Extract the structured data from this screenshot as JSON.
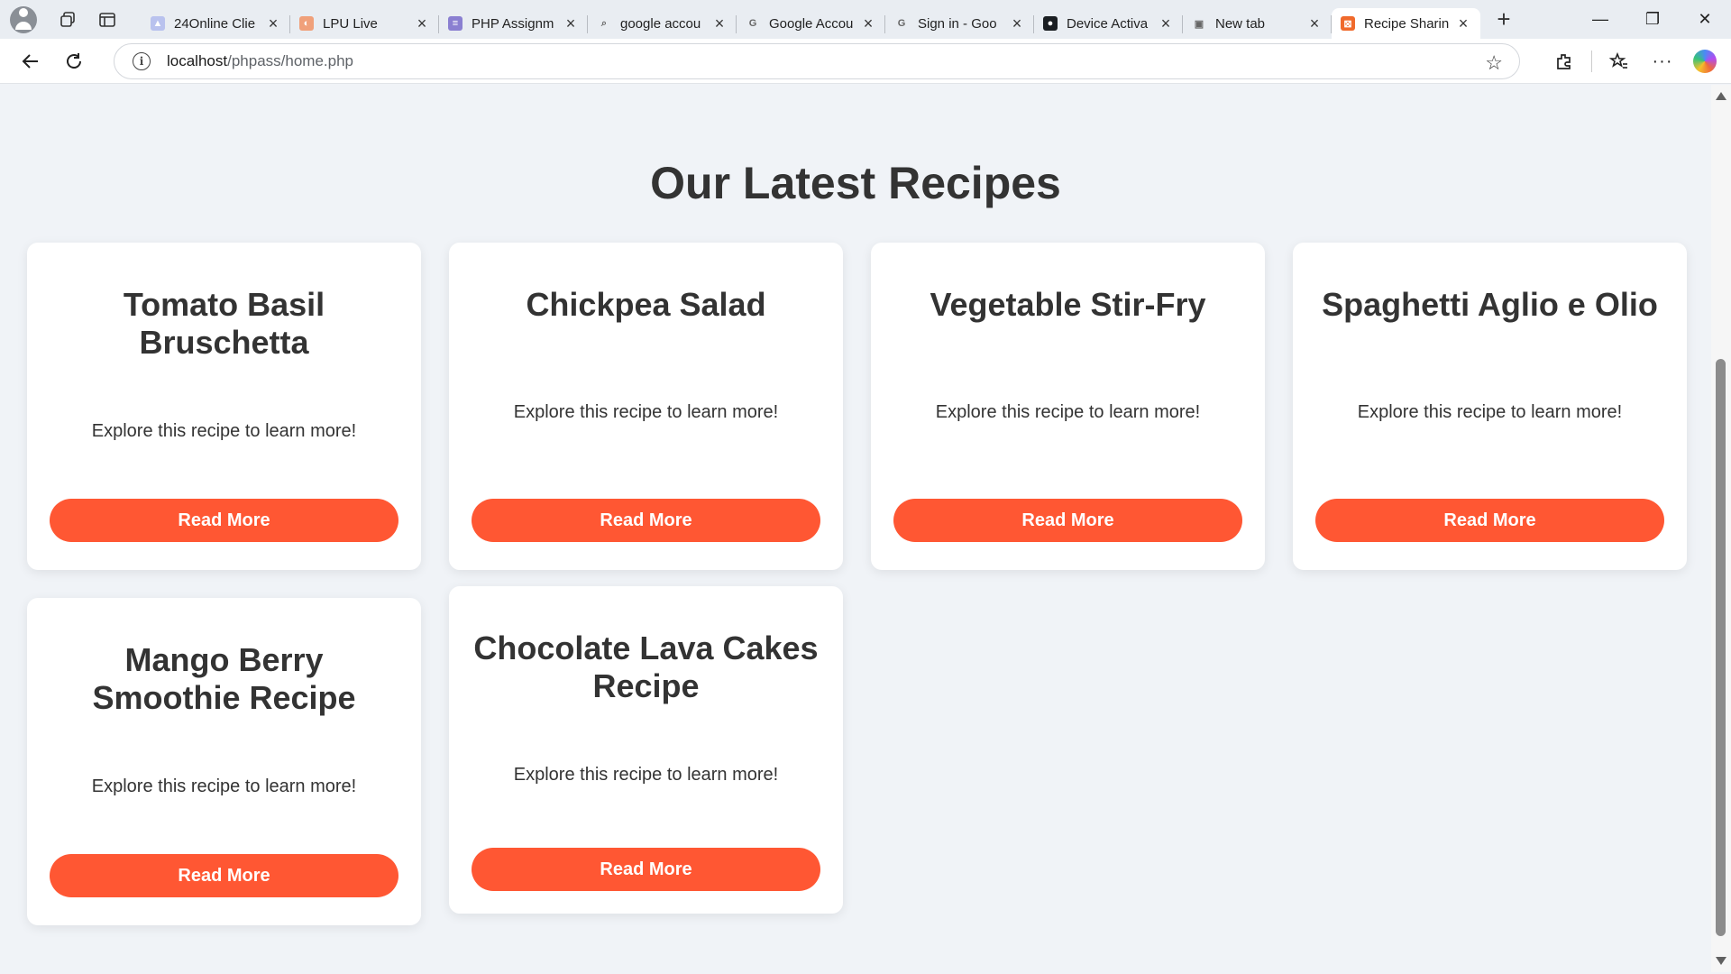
{
  "browser": {
    "tabs": [
      {
        "title": "24Online Clie",
        "favicon_color": "#b9c2ee",
        "favicon_glyph": "▲"
      },
      {
        "title": "LPU Live",
        "favicon_color": "#f0a07a",
        "favicon_glyph": "◐"
      },
      {
        "title": "PHP Assignm",
        "favicon_color": "#8a7fd1",
        "favicon_glyph": "≡"
      },
      {
        "title": "google accou",
        "favicon_color": "#e9edf2",
        "favicon_glyph": "⌕"
      },
      {
        "title": "Google Accou",
        "favicon_color": "#e9edf2",
        "favicon_glyph": "G"
      },
      {
        "title": "Sign in - Goo",
        "favicon_color": "#e9edf2",
        "favicon_glyph": "G"
      },
      {
        "title": "Device Activa",
        "favicon_color": "#1b1f23",
        "favicon_glyph": "●"
      },
      {
        "title": "New tab",
        "favicon_color": "#e9edf2",
        "favicon_glyph": "▣"
      },
      {
        "title": "Recipe Sharin",
        "favicon_color": "#f06a2c",
        "favicon_glyph": "⊠",
        "active": true
      }
    ],
    "url_host": "localhost",
    "url_path": "/phpass/home.php"
  },
  "page": {
    "heading": "Our Latest Recipes",
    "recipes": [
      {
        "title": "Tomato Basil Bruschetta",
        "description": "Explore this recipe to learn more!",
        "button": "Read More"
      },
      {
        "title": "Chickpea Salad",
        "description": "Explore this recipe to learn more!",
        "button": "Read More"
      },
      {
        "title": "Vegetable Stir-Fry",
        "description": "Explore this recipe to learn more!",
        "button": "Read More"
      },
      {
        "title": "Spaghetti Aglio e Olio",
        "description": "Explore this recipe to learn more!",
        "button": "Read More"
      },
      {
        "title": "Mango Berry Smoothie Recipe",
        "description": "Explore this recipe to learn more!",
        "button": "Read More"
      },
      {
        "title": "Chocolate Lava Cakes Recipe",
        "description": "Explore this recipe to learn more!",
        "button": "Read More"
      }
    ]
  },
  "colors": {
    "accent": "#ff5733",
    "background": "#f0f3f7",
    "card": "#ffffff",
    "text": "#333333"
  }
}
